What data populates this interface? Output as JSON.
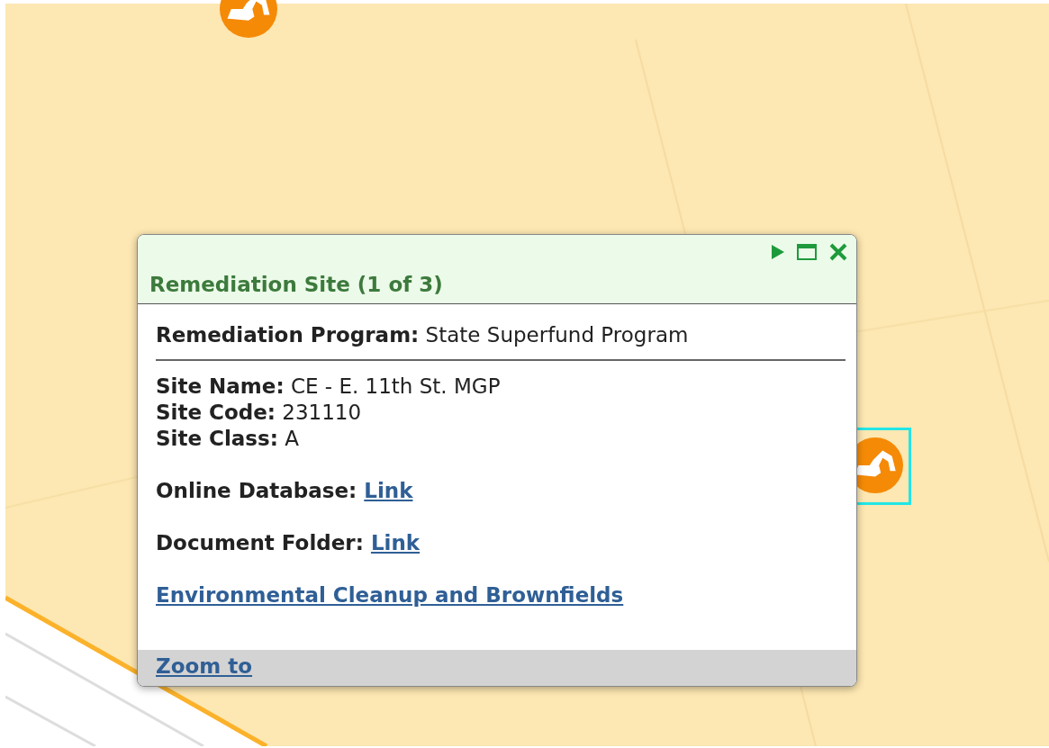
{
  "map": {
    "markers": [
      {
        "selected": false
      },
      {
        "selected": true
      }
    ]
  },
  "popup": {
    "title": "Remediation Site (1 of 3)",
    "program": "**Remediation Program:** State Superfund Program",
    "details": [
      "**Site Name:** CE - E. 11th St. MGP",
      "**Site Code:** 231110",
      "**Site Class:** A"
    ],
    "links": [
      {
        "label": "Online Database:",
        "link": "Link"
      },
      {
        "label": "Document Folder:",
        "link": "Link"
      }
    ],
    "main_link": "Environmental Cleanup and Brownfields",
    "footer_link": "Zoom to"
  }
}
